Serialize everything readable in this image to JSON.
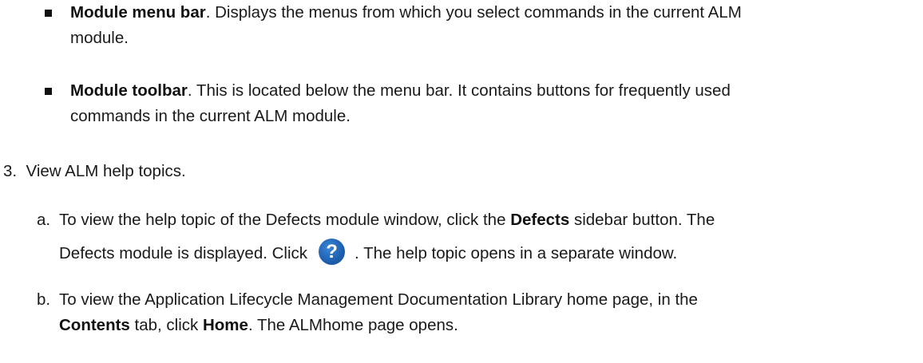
{
  "bullets": [
    {
      "bold": "Module menu bar",
      "text_line1": ". Displays the menus from which you select commands in the current ALM",
      "text_line2": "module."
    },
    {
      "bold": "Module toolbar",
      "text_line1": ". This is located below the menu bar. It contains buttons for frequently used",
      "text_line2": "commands in the current ALM module."
    }
  ],
  "step3": {
    "number": "3.",
    "text": "View ALM help topics."
  },
  "sub_a": {
    "letter": "a.",
    "line1_pre": "To view the help topic of the Defects module window, click the ",
    "line1_bold": "Defects",
    "line1_post": " sidebar button. The",
    "line2_pre": "Defects module is displayed. Click",
    "icon": "help-question-icon",
    "icon_glyph": "?",
    "line2_post": ". The help topic opens in a separate window."
  },
  "sub_b": {
    "letter": "b.",
    "line1": "To view the Application Lifecycle Management Documentation Library home page, in the",
    "line2_bold1": "Contents",
    "line2_mid": " tab, click ",
    "line2_bold2": "Home",
    "line2_post": ". The ALMhome page opens."
  }
}
